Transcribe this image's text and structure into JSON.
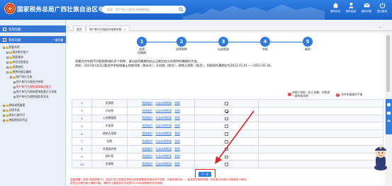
{
  "header": {
    "title": "国家税务总局广西壮族自治区电子税务局",
    "search_placeholder": "搜索：财产和行为税合并纳税申报",
    "nav": [
      {
        "label": "我的待办",
        "icon": "home-icon"
      },
      {
        "label": "我的信息",
        "icon": "user-icon"
      },
      {
        "label": "我的消息",
        "icon": "mail-icon"
      },
      {
        "label": "退出登录",
        "icon": "power-icon"
      }
    ]
  },
  "sidebar": {
    "section1": "常用功能",
    "section1_right": "",
    "section2": "系统功能",
    "section2_right": "一键折叠",
    "tree": [
      {
        "label": "我要办税",
        "level": 0
      },
      {
        "label": "税务数字账户",
        "level": 1
      },
      {
        "label": "我要查询",
        "level": 1
      },
      {
        "label": "综合信息报告",
        "level": 1
      },
      {
        "label": "发票使用",
        "level": 1
      },
      {
        "label": "税费申报及缴纳",
        "level": 1
      },
      {
        "label": "财产和行为税",
        "level": 2
      },
      {
        "label": "财产和行为税合并申报",
        "level": 3
      },
      {
        "label": "财产和行为税税源采集及更正",
        "level": 3,
        "active": true
      },
      {
        "label": "财产和行为税纳税申报更正与作废",
        "level": 3
      },
      {
        "label": "财产和行为税税源信息导出",
        "level": 3
      },
      {
        "label": "税收减免备案",
        "level": 1
      },
      {
        "label": "证明开具",
        "level": 1
      },
      {
        "label": "税务行政许可",
        "level": 1
      },
      {
        "label": "增值税抵扣凭证",
        "level": 1
      }
    ]
  },
  "tabs": [
    {
      "label": "首页"
    },
    {
      "label": "财产和行为税合并纳税申报"
    }
  ],
  "steps": [
    {
      "num": "1",
      "label": "选择\n所属期"
    },
    {
      "num": "2",
      "label": "选择税种"
    },
    {
      "num": "3",
      "label": "勾选税源"
    },
    {
      "num": "4",
      "label": "申报"
    },
    {
      "num": "5",
      "label": "缴款"
    }
  ],
  "description": [
    "如需合并申报不同税税期限的多个税种，请勾选所属期的起止日期比较久的税种所属期间为准。",
    "例如：2022年4月3日要合并申报城镇土地使用税（按半年），印花税（按次），耕地占用税（按次），则税款所属期应为2022.01.01——2022.06.30。"
  ],
  "legend": {
    "item1": "本期已申报（含已采集）的税源",
    "item1_sub": "一键申报本期",
    "item2": "合并申报操作手册"
  },
  "table": {
    "rows": [
      {
        "no": "2",
        "name": "资源税",
        "checked": false
      },
      {
        "no": "3",
        "name": "印花税",
        "checked": true
      },
      {
        "no": "4",
        "name": "土地增值税",
        "checked": false
      },
      {
        "no": "5",
        "name": "车船税",
        "checked": false
      },
      {
        "no": "6",
        "name": "耕地占用税",
        "checked": false
      },
      {
        "no": "7",
        "name": "契税",
        "checked": false
      },
      {
        "no": "8",
        "name": "环境保护税",
        "checked": false
      },
      {
        "no": "9",
        "name": "烟叶税",
        "checked": false
      },
      {
        "no": "10",
        "name": "资源税",
        "checked": false
      }
    ],
    "link1": "税源维护",
    "link2": "勾选本期税源",
    "link3": "税源"
  },
  "next_button": "下一步",
  "footer": [
    "温馨提醒：选择“税款属期”时，若您已录入税源后再修改税款属期使税源信息不完整，本期申报时将……新选择本期的税源，或在更正申报时对税源进行修改。",
    "若您在办理过程中遇到问题，请联系主管税务机关或拨打12366纳税服务热线咨询。"
  ]
}
